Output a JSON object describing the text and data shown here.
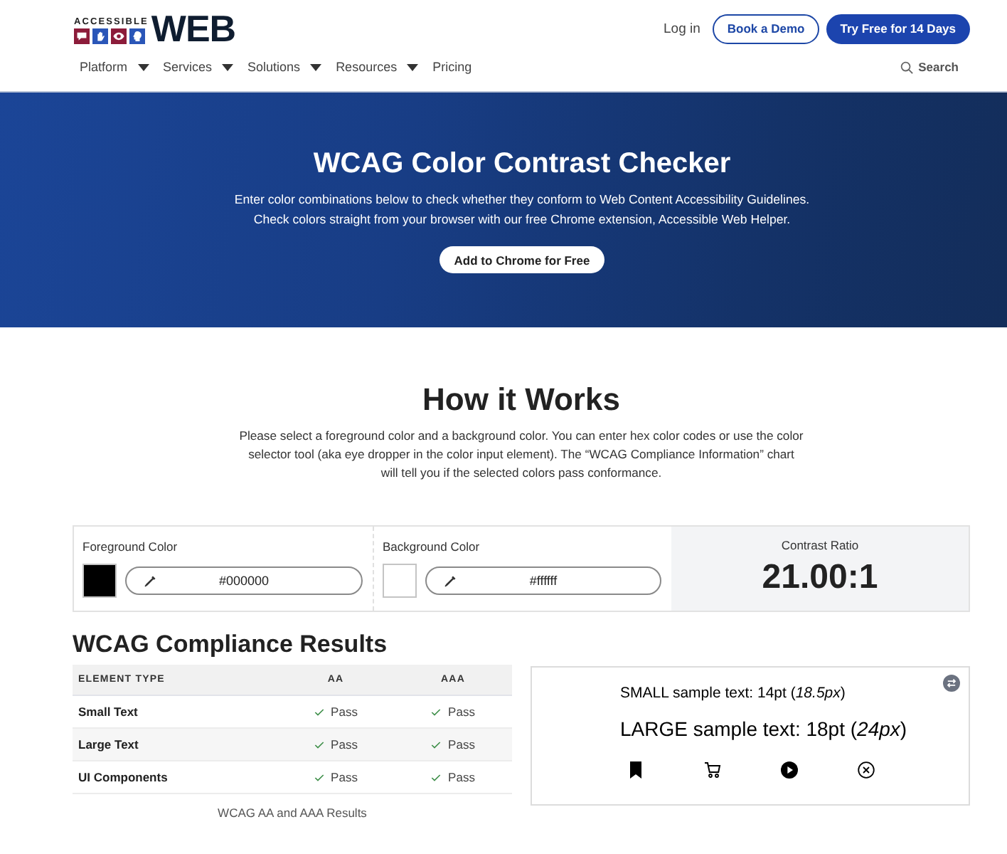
{
  "header": {
    "logo": {
      "small_text": "ACCESSIBLE",
      "wordmark": "WEB"
    },
    "login": "Log in",
    "buttons": [
      {
        "label": "Book a Demo",
        "kind": "outline"
      },
      {
        "label": "Try Free for 14 Days",
        "kind": "solid"
      }
    ],
    "nav": [
      {
        "label": "Platform",
        "has_menu": true
      },
      {
        "label": "Services",
        "has_menu": true
      },
      {
        "label": "Solutions",
        "has_menu": true
      },
      {
        "label": "Resources",
        "has_menu": true
      },
      {
        "label": "Pricing",
        "has_menu": false
      }
    ],
    "search": "Search"
  },
  "hero": {
    "title": "WCAG Color Contrast Checker",
    "description": [
      "Enter color combinations below to check whether they conform to Web Content Accessibility Guidelines.",
      "Check colors straight from your browser with our free Chrome extension, Accessible Web Helper."
    ],
    "button": "Add to Chrome for Free"
  },
  "how_it_works": {
    "title": "How it Works",
    "description": [
      "Please select a foreground color and a background color. You can enter hex color codes or use the color",
      "selector tool (aka eye dropper in the color input element). The “WCAG Compliance Information” chart",
      "will tell you if the selected colors pass conformance."
    ]
  },
  "color_inputs": [
    {
      "label": "Foreground Color",
      "value": "#000000"
    },
    {
      "label": "Background Color",
      "value": "#ffffff"
    }
  ],
  "contrast": {
    "label": "Contrast Ratio",
    "value": "21.00:1"
  },
  "results": {
    "title": "WCAG Compliance Results",
    "columns": [
      "ELEMENT TYPE",
      "AA",
      "AAA"
    ],
    "rows": [
      {
        "cells": [
          {
            "kind": "label",
            "text": "Small Text"
          },
          {
            "kind": "result",
            "text": "Pass",
            "passed": true
          },
          {
            "kind": "result",
            "text": "Pass",
            "passed": true
          }
        ]
      },
      {
        "cells": [
          {
            "kind": "label",
            "text": "Large Text"
          },
          {
            "kind": "result",
            "text": "Pass",
            "passed": true
          },
          {
            "kind": "result",
            "text": "Pass",
            "passed": true
          }
        ]
      },
      {
        "cells": [
          {
            "kind": "label",
            "text": "UI Components"
          },
          {
            "kind": "result",
            "text": "Pass",
            "passed": true
          },
          {
            "kind": "result",
            "text": "Pass",
            "passed": true
          }
        ]
      }
    ],
    "caption": "WCAG AA and AAA Results"
  },
  "sample": {
    "small_text": "SMALL sample text: 14pt (*18.5px*)",
    "large_text": "LARGE sample text: 18pt (*24px*)"
  }
}
